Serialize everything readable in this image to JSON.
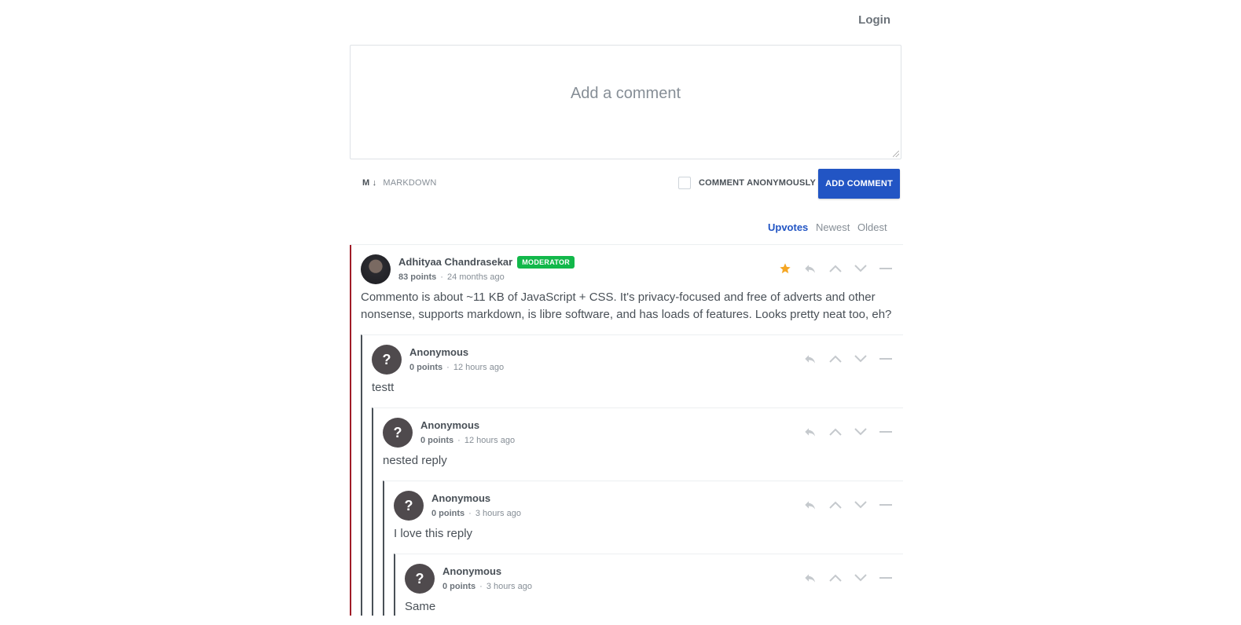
{
  "header": {
    "login_label": "Login"
  },
  "composer": {
    "placeholder": "Add a comment",
    "markdown_icon": "M ↓",
    "markdown_label": "MARKDOWN",
    "anonymous_label": "COMMENT ANONYMOUSLY",
    "anonymous_checked": false,
    "submit_label": "ADD COMMENT"
  },
  "sort": {
    "options": [
      "Upvotes",
      "Newest",
      "Oldest"
    ],
    "active": "Upvotes"
  },
  "colors": {
    "accent": "#2255c4",
    "moderator_badge": "#12b84a",
    "star": "#f5a623",
    "root_thread_border": "#a01b27"
  },
  "comments": [
    {
      "name": "Adhityaa Chandrasekar",
      "badge": "MODERATOR",
      "points": "83 points",
      "time": "24 months ago",
      "text": "Commento is about ~11 KB of JavaScript + CSS. It's privacy-focused and free of adverts and other nonsense, supports markdown, is libre software, and has loads of features. Looks pretty neat too, eh?",
      "sticky": true
    },
    {
      "name": "Anonymous",
      "avatar": "?",
      "points": "0 points",
      "time": "12 hours ago",
      "text": "testt"
    },
    {
      "name": "Anonymous",
      "avatar": "?",
      "points": "0 points",
      "time": "12 hours ago",
      "text": "nested reply"
    },
    {
      "name": "Anonymous",
      "avatar": "?",
      "points": "0 points",
      "time": "3 hours ago",
      "text": "I love this reply"
    },
    {
      "name": "Anonymous",
      "avatar": "?",
      "points": "0 points",
      "time": "3 hours ago",
      "text": "Same"
    }
  ],
  "separator": "·",
  "icons": {
    "sticky": "star-icon",
    "reply": "reply-icon",
    "upvote": "upvote-icon",
    "downvote": "downvote-icon",
    "collapse": "collapse-icon"
  }
}
